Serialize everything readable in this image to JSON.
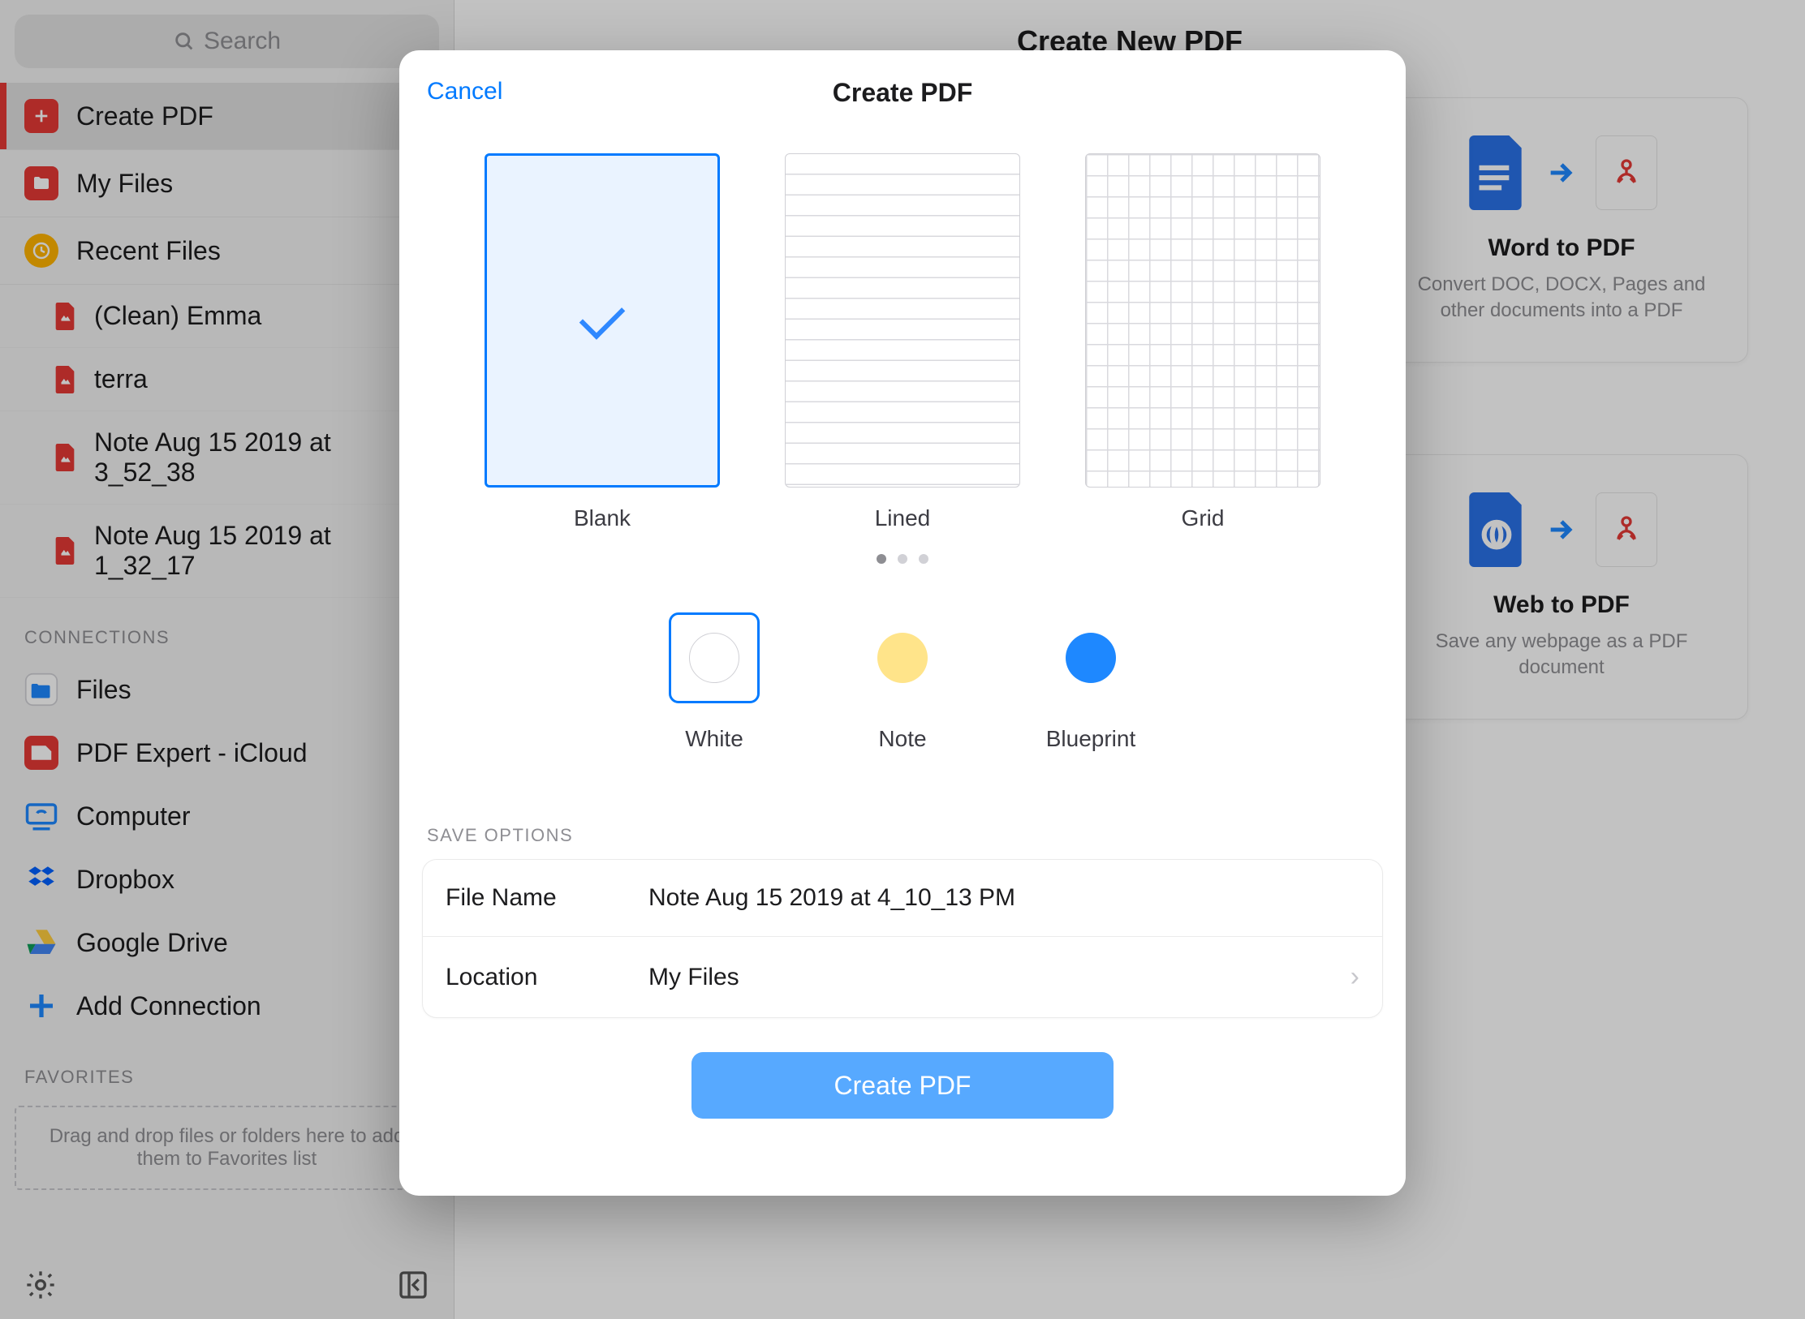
{
  "sidebar": {
    "search_placeholder": "Search",
    "items": [
      {
        "icon": "plus",
        "label": "Create PDF"
      },
      {
        "icon": "folder",
        "label": "My Files"
      },
      {
        "icon": "clock",
        "label": "Recent Files"
      }
    ],
    "recents": [
      {
        "label": "(Clean) Emma"
      },
      {
        "label": "terra"
      },
      {
        "label": "Note Aug 15 2019 at 3_52_38"
      },
      {
        "label": "Note Aug 15 2019 at 1_32_17"
      }
    ],
    "connections_header": "CONNECTIONS",
    "connections": [
      {
        "icon": "folder-blue",
        "label": "Files"
      },
      {
        "icon": "pdfexpert",
        "label": "PDF Expert - iCloud"
      },
      {
        "icon": "computer",
        "label": "Computer"
      },
      {
        "icon": "dropbox",
        "label": "Dropbox"
      },
      {
        "icon": "gdrive",
        "label": "Google Drive"
      },
      {
        "icon": "add",
        "label": "Add Connection"
      }
    ],
    "favorites_header": "FAVORITES",
    "favorites_hint": "Drag and drop files or folders here to add them to Favorites list"
  },
  "main": {
    "title": "Create New PDF",
    "cards": [
      {
        "title": "Word to PDF",
        "subtitle": "Convert DOC, DOCX, Pages and other documents into a PDF"
      },
      {
        "title": "Web to PDF",
        "subtitle": "Save any webpage as a PDF document"
      }
    ]
  },
  "modal": {
    "cancel": "Cancel",
    "title": "Create PDF",
    "templates": [
      {
        "key": "blank",
        "label": "Blank",
        "selected": true
      },
      {
        "key": "lined",
        "label": "Lined",
        "selected": false
      },
      {
        "key": "grid",
        "label": "Grid",
        "selected": false
      }
    ],
    "page_indicator": {
      "count": 3,
      "active": 0
    },
    "colors": [
      {
        "key": "white",
        "label": "White",
        "hex": "#ffffff",
        "selected": true
      },
      {
        "key": "note",
        "label": "Note",
        "hex": "#ffe48a",
        "selected": false
      },
      {
        "key": "blueprint",
        "label": "Blueprint",
        "hex": "#1e88ff",
        "selected": false
      }
    ],
    "save_options_header": "SAVE OPTIONS",
    "file_name_label": "File Name",
    "file_name_value": "Note Aug 15 2019 at 4_10_13 PM",
    "location_label": "Location",
    "location_value": "My Files",
    "create_button": "Create PDF"
  }
}
